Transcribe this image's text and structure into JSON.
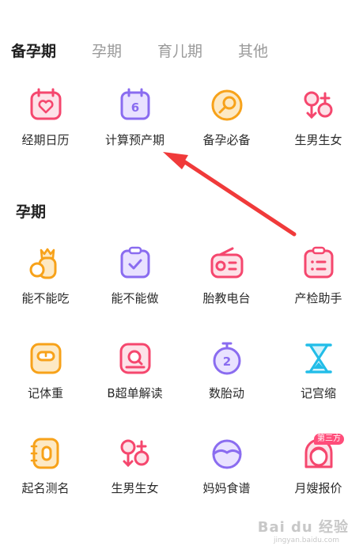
{
  "tabs": [
    {
      "label": "备孕期",
      "active": true
    },
    {
      "label": "孕期",
      "active": false
    },
    {
      "label": "育儿期",
      "active": false
    },
    {
      "label": "其他",
      "active": false
    }
  ],
  "prep_section": {
    "tools": [
      {
        "label": "经期日历",
        "icon": "calendar-heart-icon"
      },
      {
        "label": "计算预产期",
        "icon": "calendar-six-icon",
        "icon_text": "6"
      },
      {
        "label": "备孕必备",
        "icon": "egg-icon"
      },
      {
        "label": "生男生女",
        "icon": "gender-icon"
      }
    ]
  },
  "pregnancy_section": {
    "title": "孕期",
    "tools": [
      {
        "label": "能不能吃",
        "icon": "pineapple-icon"
      },
      {
        "label": "能不能做",
        "icon": "clipboard-check-icon"
      },
      {
        "label": "胎教电台",
        "icon": "radio-icon"
      },
      {
        "label": "产检助手",
        "icon": "checklist-icon"
      },
      {
        "label": "记体重",
        "icon": "scale-icon"
      },
      {
        "label": "B超单解读",
        "icon": "ultrasound-icon"
      },
      {
        "label": "数胎动",
        "icon": "stopwatch-icon",
        "icon_text": "2"
      },
      {
        "label": "记宫缩",
        "icon": "hourglass-icon"
      },
      {
        "label": "起名测名",
        "icon": "name-book-icon"
      },
      {
        "label": "生男生女",
        "icon": "gender-icon"
      },
      {
        "label": "妈妈食谱",
        "icon": "bowl-icon"
      },
      {
        "label": "月嫂报价",
        "icon": "nanny-icon",
        "badge": "第三方"
      }
    ]
  },
  "watermark": {
    "brand": "Bai du 经验",
    "url": "jingyan.baidu.com"
  },
  "colors": {
    "pink": "#f5476e",
    "purple": "#8a6cf0",
    "orange": "#f7a21a",
    "cyan": "#22bde8",
    "arrow": "#f03a3a"
  }
}
